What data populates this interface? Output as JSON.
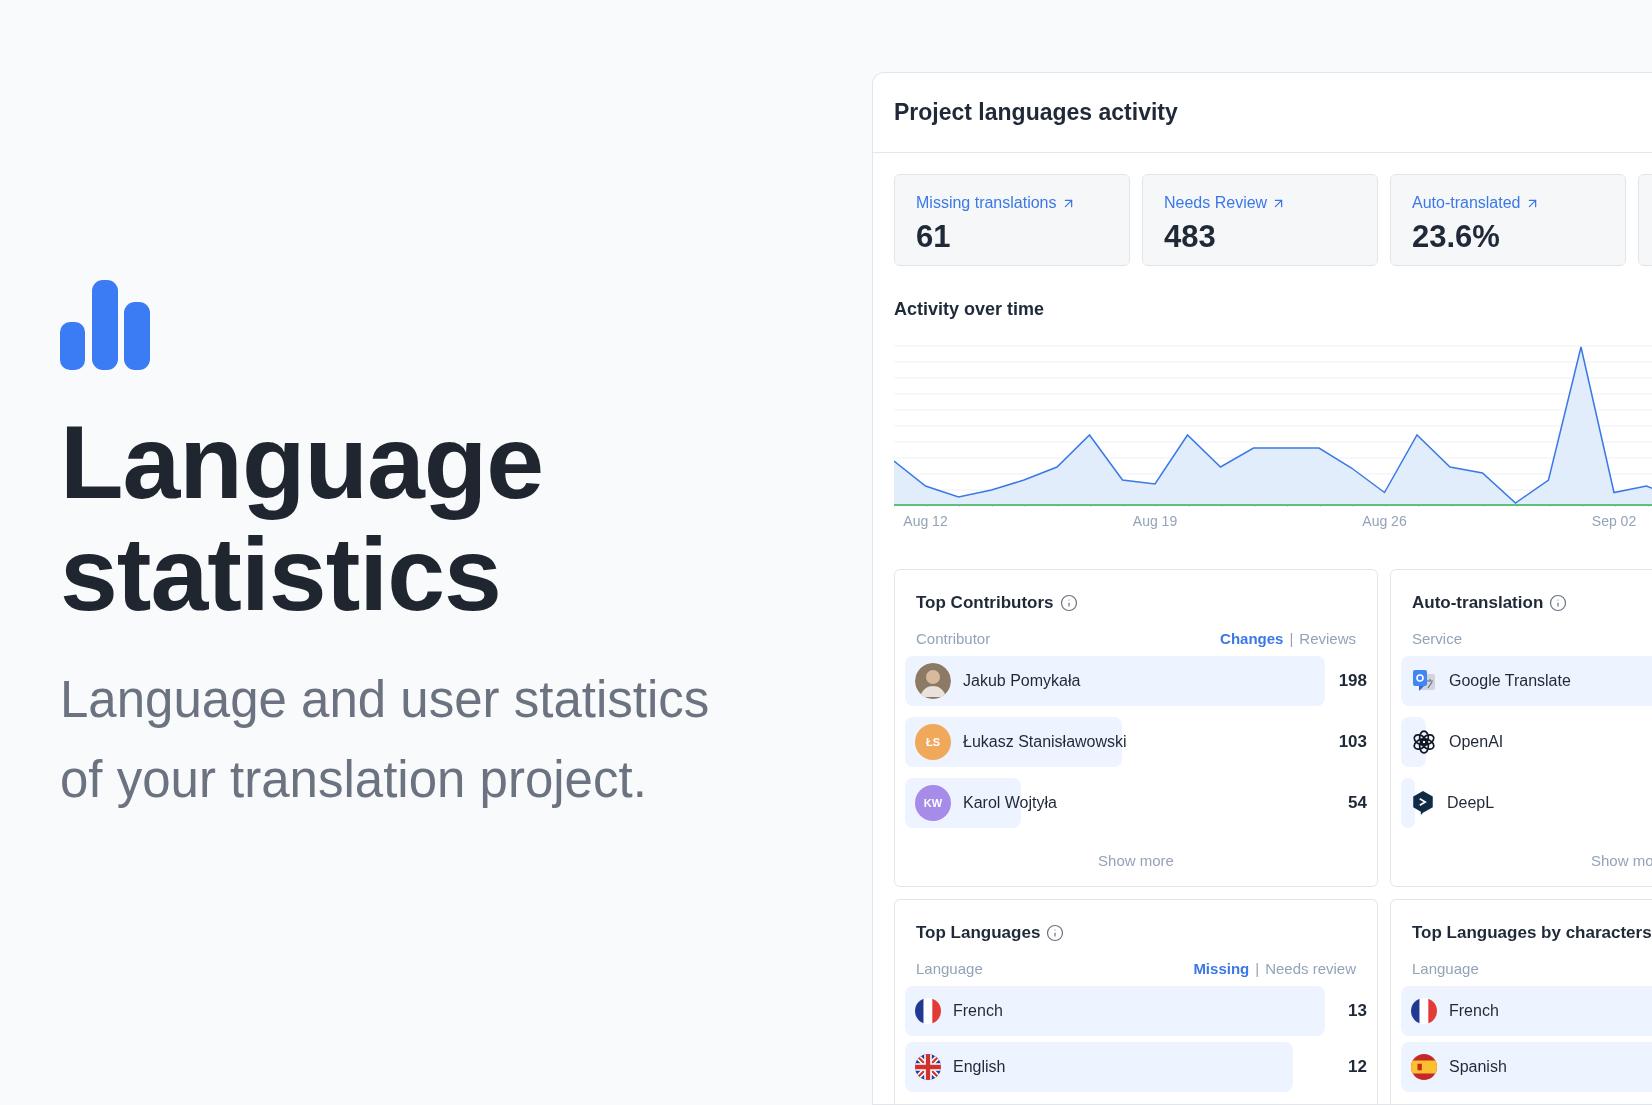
{
  "hero": {
    "title": "Language statistics",
    "subtitle": "Language and user statistics of your translation project."
  },
  "panel": {
    "title": "Project languages activity",
    "stats": [
      {
        "label": "Missing translations",
        "value": "61"
      },
      {
        "label": "Needs Review",
        "value": "483"
      },
      {
        "label": "Auto-translated",
        "value": "23.6%"
      }
    ],
    "activity": {
      "title": "Activity over time",
      "x_labels": [
        "Aug 12",
        "Aug 19",
        "Aug 26",
        "Sep 02"
      ]
    },
    "contributors": {
      "title": "Top Contributors",
      "column": "Contributor",
      "metrics": [
        {
          "label": "Changes",
          "selected": true
        },
        {
          "label": "Reviews",
          "selected": false
        }
      ],
      "separator": "|",
      "rows": [
        {
          "name": "Jakub Pomykała",
          "kind": "photo",
          "count": "198",
          "level": 0.91
        },
        {
          "name": "Łukasz Stanisławowski",
          "kind": "initials",
          "initials": "ŁS",
          "color": "#f0a95a",
          "count": "103",
          "level": 0.47
        },
        {
          "name": "Karol Wojtyła",
          "kind": "initials",
          "initials": "KW",
          "color": "#a78be8",
          "count": "54",
          "level": 0.25
        }
      ],
      "show_more": "Show more"
    },
    "auto_translation": {
      "title": "Auto-translation",
      "column": "Service",
      "rows": [
        {
          "name": "Google Translate",
          "kind": "translate",
          "level": 0.9
        },
        {
          "name": "OpenAI",
          "kind": "knot",
          "level": 0.054
        },
        {
          "name": "DeepL",
          "kind": "hexagon",
          "level": 0.03
        }
      ],
      "show_more": "Show mo"
    },
    "languages": {
      "title": "Top Languages",
      "column": "Language",
      "metrics": [
        {
          "label": "Missing",
          "selected": true
        },
        {
          "label": "Needs review",
          "selected": false
        }
      ],
      "separator": "|",
      "rows": [
        {
          "name": "French",
          "kind": "fr",
          "count": "13",
          "level": 0.91
        },
        {
          "name": "English",
          "kind": "gb",
          "count": "12",
          "level": 0.84
        }
      ]
    },
    "languages_by_characters": {
      "title": "Top Languages by characters",
      "column": "Language",
      "rows": [
        {
          "name": "French",
          "kind": "fr",
          "level": 0.9
        },
        {
          "name": "Spanish",
          "kind": "es",
          "level": 0.9
        }
      ]
    }
  }
}
